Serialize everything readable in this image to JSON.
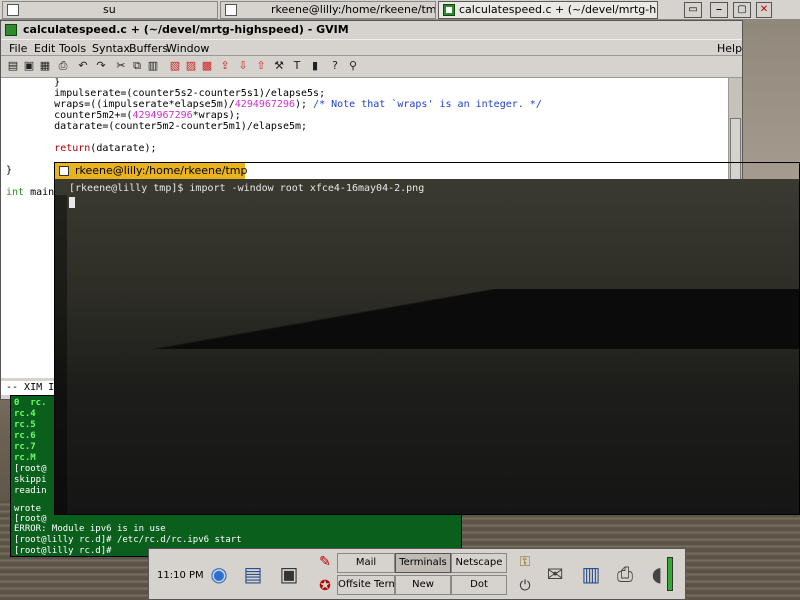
{
  "taskbar": {
    "tasks": [
      {
        "label": "su"
      },
      {
        "label": "rkeene@lilly:/home/rkeene/tmp"
      },
      {
        "label": "calculatespeed.c + (~/devel/mrtg-highspeed)"
      }
    ],
    "controls": [
      "▭",
      "⎯",
      "▢",
      "✕"
    ]
  },
  "gvim": {
    "title": "calculatespeed.c + (~/devel/mrtg-highspeed) - GVIM",
    "menu": [
      "File",
      "Edit",
      "Tools",
      "Syntax",
      "Buffers",
      "Window",
      "Help"
    ],
    "status": "-- XIM I"
  },
  "code": {
    "l1": "        }",
    "l2": "        impulserate=(counter5s2-counter5s1)/elapse5s;",
    "l3a": "        wraps=((impulserate*elapse5m)/",
    "l3n": "4294967296",
    "l3b": "); ",
    "l3c": "/* Note that `wraps' is an integer. */",
    "l4a": "        counter5m2+=(",
    "l4n": "4294967296",
    "l4b": "*wraps);",
    "l5": "        datarate=(counter5m2-counter5m1)/elapse5m;",
    "l6a": "        ",
    "l6k": "return",
    "l6b": "(datarate);",
    "l7": "}",
    "l8k": "int",
    "l8b": " main"
  },
  "terminal_dark": {
    "title": "rkeene@lilly:/home/rkeene/tmp",
    "command": "[rkeene@lilly tmp]$ import -window root xfce4-16may04-2.png"
  },
  "terminal_green": {
    "lines": [
      "0  rc.",
      "rc.4",
      "rc.5",
      "rc.6",
      "rc.7",
      "rc.M",
      "[root@",
      "skippi",
      "readin",
      "",
      "wrote ",
      "[root@",
      "ERROR: Module ipv6 is in use",
      "[root@lilly rc.d]# /etc/rc.d/rc.ipv6 start",
      "[root@lilly rc.d]# "
    ]
  },
  "panel": {
    "clock": "11:10 PM",
    "buttons": {
      "mail": "Mail",
      "offsite": "Offsite Term",
      "terminals": "Terminals",
      "new": "New",
      "netscape": "Netscape",
      "dot": "Dot"
    }
  }
}
